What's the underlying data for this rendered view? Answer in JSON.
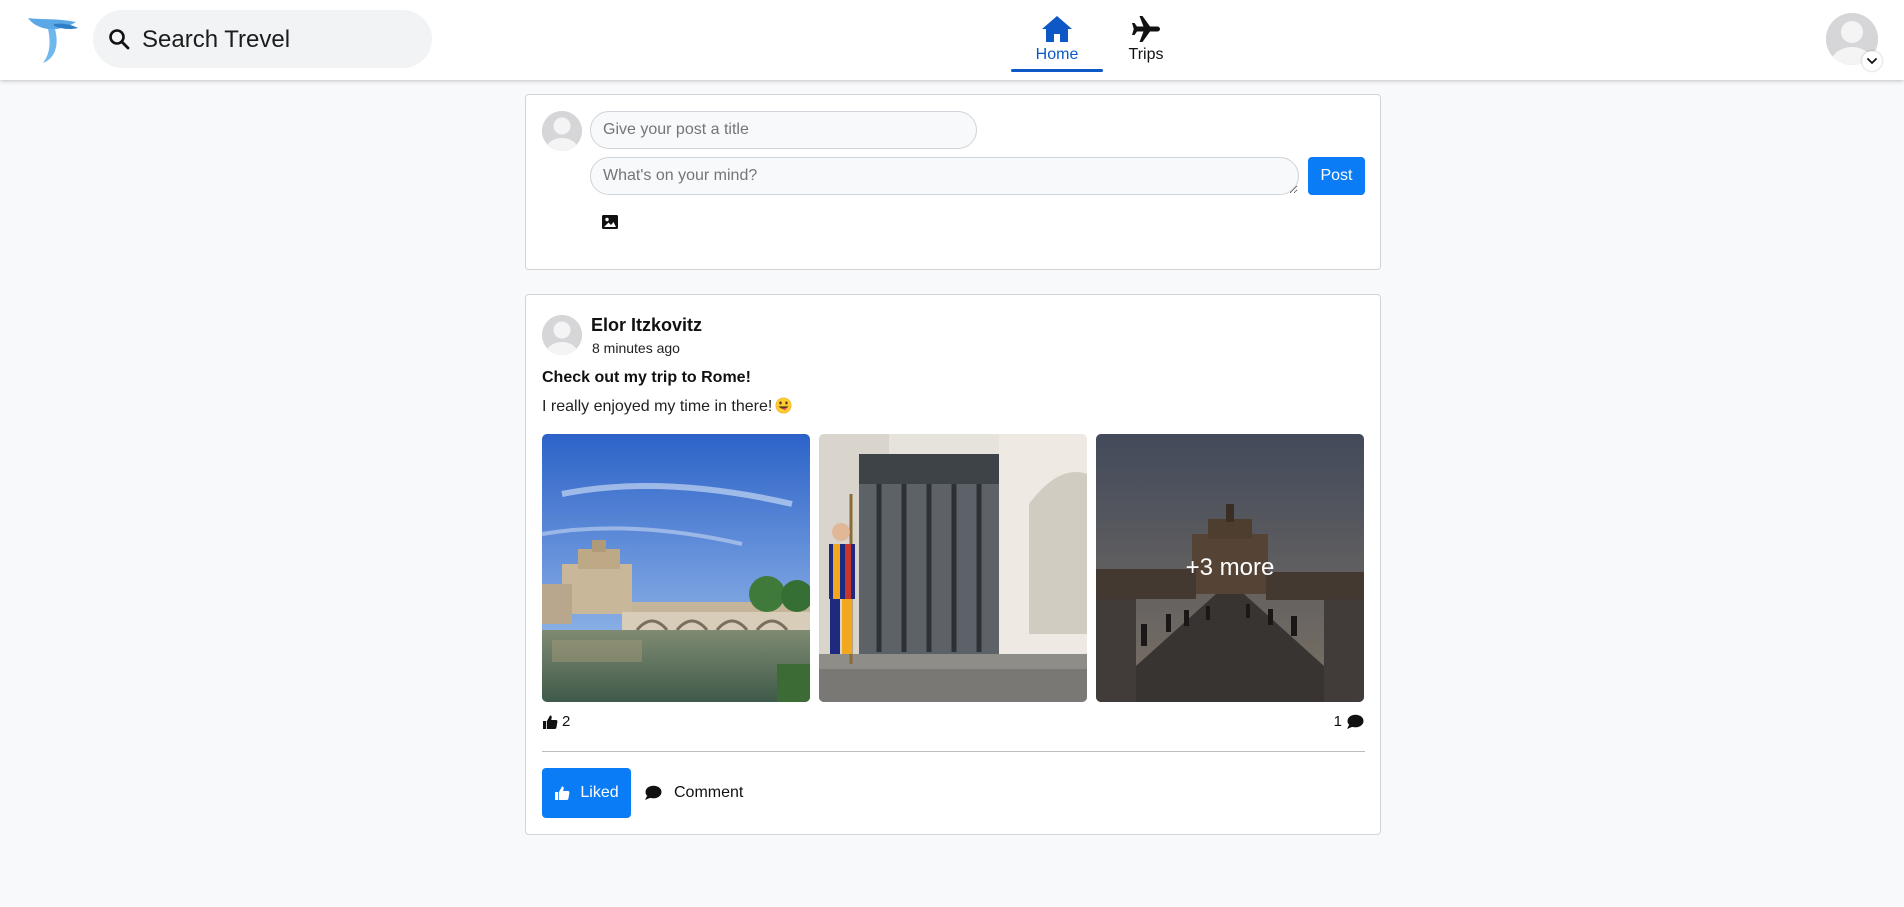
{
  "header": {
    "logo_icon": "travel-logo-icon",
    "search": {
      "icon": "search-icon",
      "text": "Search Trevel"
    },
    "tabs": [
      {
        "label": "Home",
        "icon": "home-icon",
        "active": true
      },
      {
        "label": "Trips",
        "icon": "airplane-icon",
        "active": false
      }
    ],
    "profile": {
      "icon": "avatar-icon",
      "menu_icon": "chevron-down-icon"
    }
  },
  "composer": {
    "title_placeholder": "Give your post a title",
    "body_placeholder": "What's on your mind?",
    "post_label": "Post",
    "image_icon": "image-icon"
  },
  "post": {
    "author": "Elor Itzkovitz",
    "time": "8 minutes ago",
    "title": "Check out my trip to Rome!",
    "body": "I really enjoyed my time in there!",
    "emoji": "grinning-tongue-face-emoji",
    "photos": [
      "castel-sant-angelo-photo",
      "swiss-guard-photo",
      "bridge-at-dusk-photo"
    ],
    "more_label": "+3 more",
    "likes": "2",
    "comments": "1",
    "liked_label": "Liked",
    "comment_label": "Comment"
  },
  "colors": {
    "accent": "#0a7cf5",
    "nav_active": "#0d58c6",
    "background": "#f8f9fb"
  }
}
